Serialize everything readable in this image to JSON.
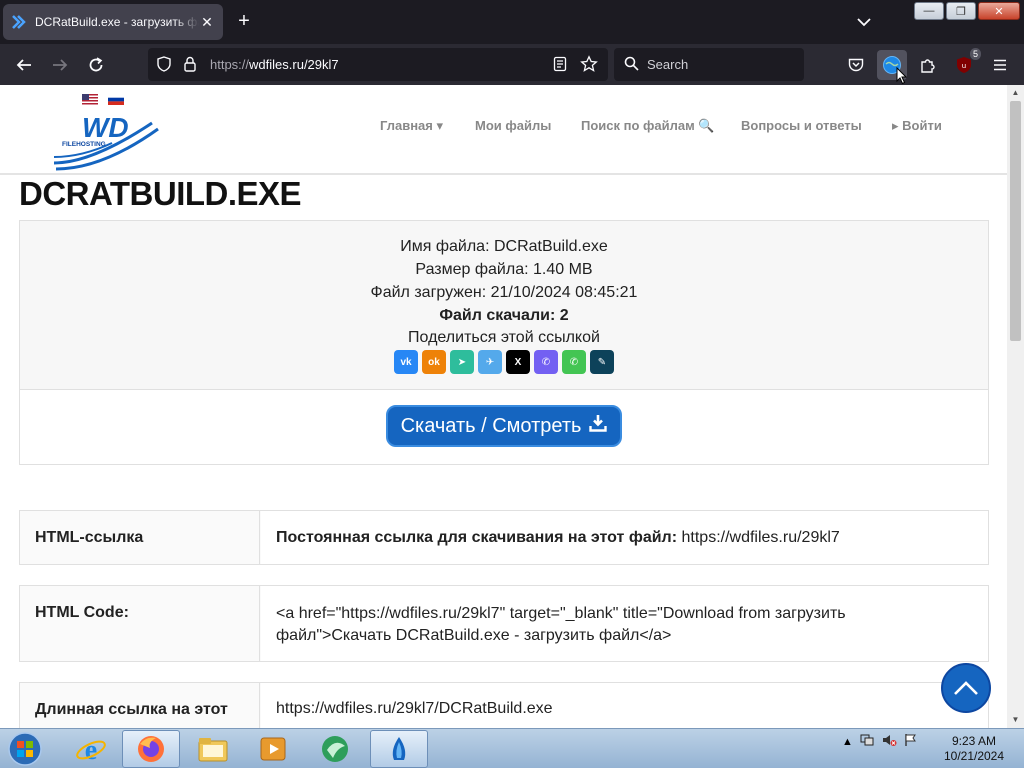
{
  "browser": {
    "tab_title": "DCRatBuild.exe - загрузить фай",
    "url_scheme": "https://",
    "url_host": "wdfiles.ru/29kl7",
    "search_placeholder": "Search",
    "ext_badge_count": "5"
  },
  "site": {
    "logo_text": "WD",
    "logo_subtext": "FILEHOSTING",
    "nav": [
      {
        "label": "Главная ▾"
      },
      {
        "label": "Мои файлы"
      },
      {
        "label": "Поиск по файлам 🔍"
      },
      {
        "label": "Вопросы и ответы"
      },
      {
        "label": "▸ Войти"
      }
    ]
  },
  "file": {
    "title": "DCRATBUILD.EXE",
    "name_line": "Имя файла: DCRatBuild.exe",
    "size_line": "Размер файла: 1.40 MB",
    "uploaded_line": "Файл загружен: 21/10/2024 08:45:21",
    "downloads_line": "Файл скачали: 2",
    "share_label": "Поделиться этой ссылкой",
    "download_button": "Скачать / Смотреть"
  },
  "share_icons": [
    {
      "name": "vk-icon",
      "glyph": "vk",
      "color": "#2787f5"
    },
    {
      "name": "odnoklassniki-icon",
      "glyph": "ok",
      "color": "#ee8208"
    },
    {
      "name": "send-icon",
      "glyph": "➤",
      "color": "#2ebd9c"
    },
    {
      "name": "telegram-icon",
      "glyph": "✈",
      "color": "#54a9eb"
    },
    {
      "name": "x-icon",
      "glyph": "X",
      "color": "#000000"
    },
    {
      "name": "viber-icon",
      "glyph": "✆",
      "color": "#7360f2"
    },
    {
      "name": "whatsapp-icon",
      "glyph": "✆",
      "color": "#43c553"
    },
    {
      "name": "livejournal-icon",
      "glyph": "✎",
      "color": "#0d425a"
    }
  ],
  "table": {
    "html_link_label": "HTML-ссылка",
    "html_link_prefix": "Постоянная ссылка для скачивания на этот файл:",
    "html_link_url": "https://wdfiles.ru/29kl7",
    "html_code_label": "HTML Code:",
    "html_code_line1": "<a href=\"https://wdfiles.ru/29kl7\" target=\"_blank\" title=\"Download from загрузить",
    "html_code_line2": "файл\">Скачать DCRatBuild.exe - загрузить файл</a>",
    "long_link_label": "Длинная ссылка на этот",
    "long_link_url": "https://wdfiles.ru/29kl7/DCRatBuild.exe"
  },
  "taskbar": {
    "time": "9:23 AM",
    "date": "10/21/2024"
  }
}
